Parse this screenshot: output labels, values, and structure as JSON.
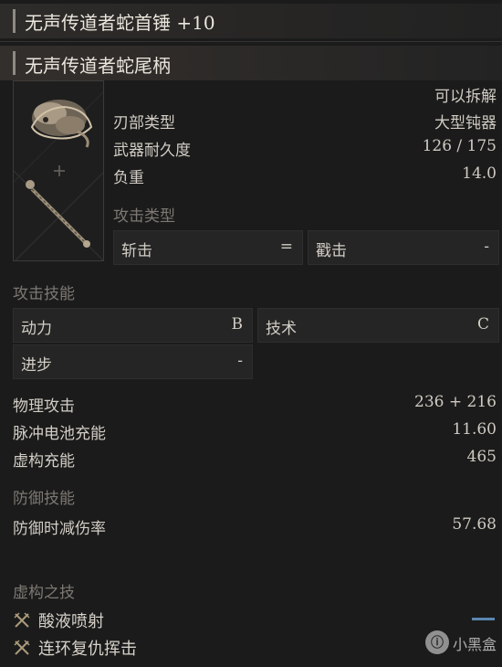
{
  "item": {
    "title": "无声传道者蛇首锤 +10",
    "handle_name": "无声传道者蛇尾柄"
  },
  "info": {
    "dismantle": "可以拆解",
    "blade_type_label": "刃部类型",
    "blade_type_value": "大型钝器",
    "durability_label": "武器耐久度",
    "durability_value": "126 / 175",
    "weight_label": "负重",
    "weight_value": "14.0"
  },
  "attack_type": {
    "header": "攻击类型",
    "cells": [
      {
        "label": "斩击",
        "value": "="
      },
      {
        "label": "戳击",
        "value": "-"
      }
    ]
  },
  "attack_skill": {
    "header": "攻击技能",
    "cells": [
      {
        "label": "动力",
        "value": "B"
      },
      {
        "label": "技术",
        "value": "C"
      },
      {
        "label": "进步",
        "value": "-"
      }
    ]
  },
  "stats": [
    {
      "label": "物理攻击",
      "value": "236 + 216"
    },
    {
      "label": "脉冲电池充能",
      "value": "11.60"
    },
    {
      "label": "虚构充能",
      "value": "465"
    }
  ],
  "defense_skill": {
    "header": "防御技能",
    "label": "防御时减伤率",
    "value": "57.68"
  },
  "fable_arts": {
    "header": "虚构之技",
    "items": [
      {
        "name": "酸液喷射",
        "icon": "crossed-swords-icon"
      },
      {
        "name": "连环复仇挥击",
        "icon": "crossed-swords-icon"
      }
    ]
  },
  "watermark": {
    "logo_text": "ⓘ",
    "text": "小黑盒"
  },
  "colors": {
    "background": "#1b1b1b",
    "accent_blue": "#5a86b0"
  }
}
